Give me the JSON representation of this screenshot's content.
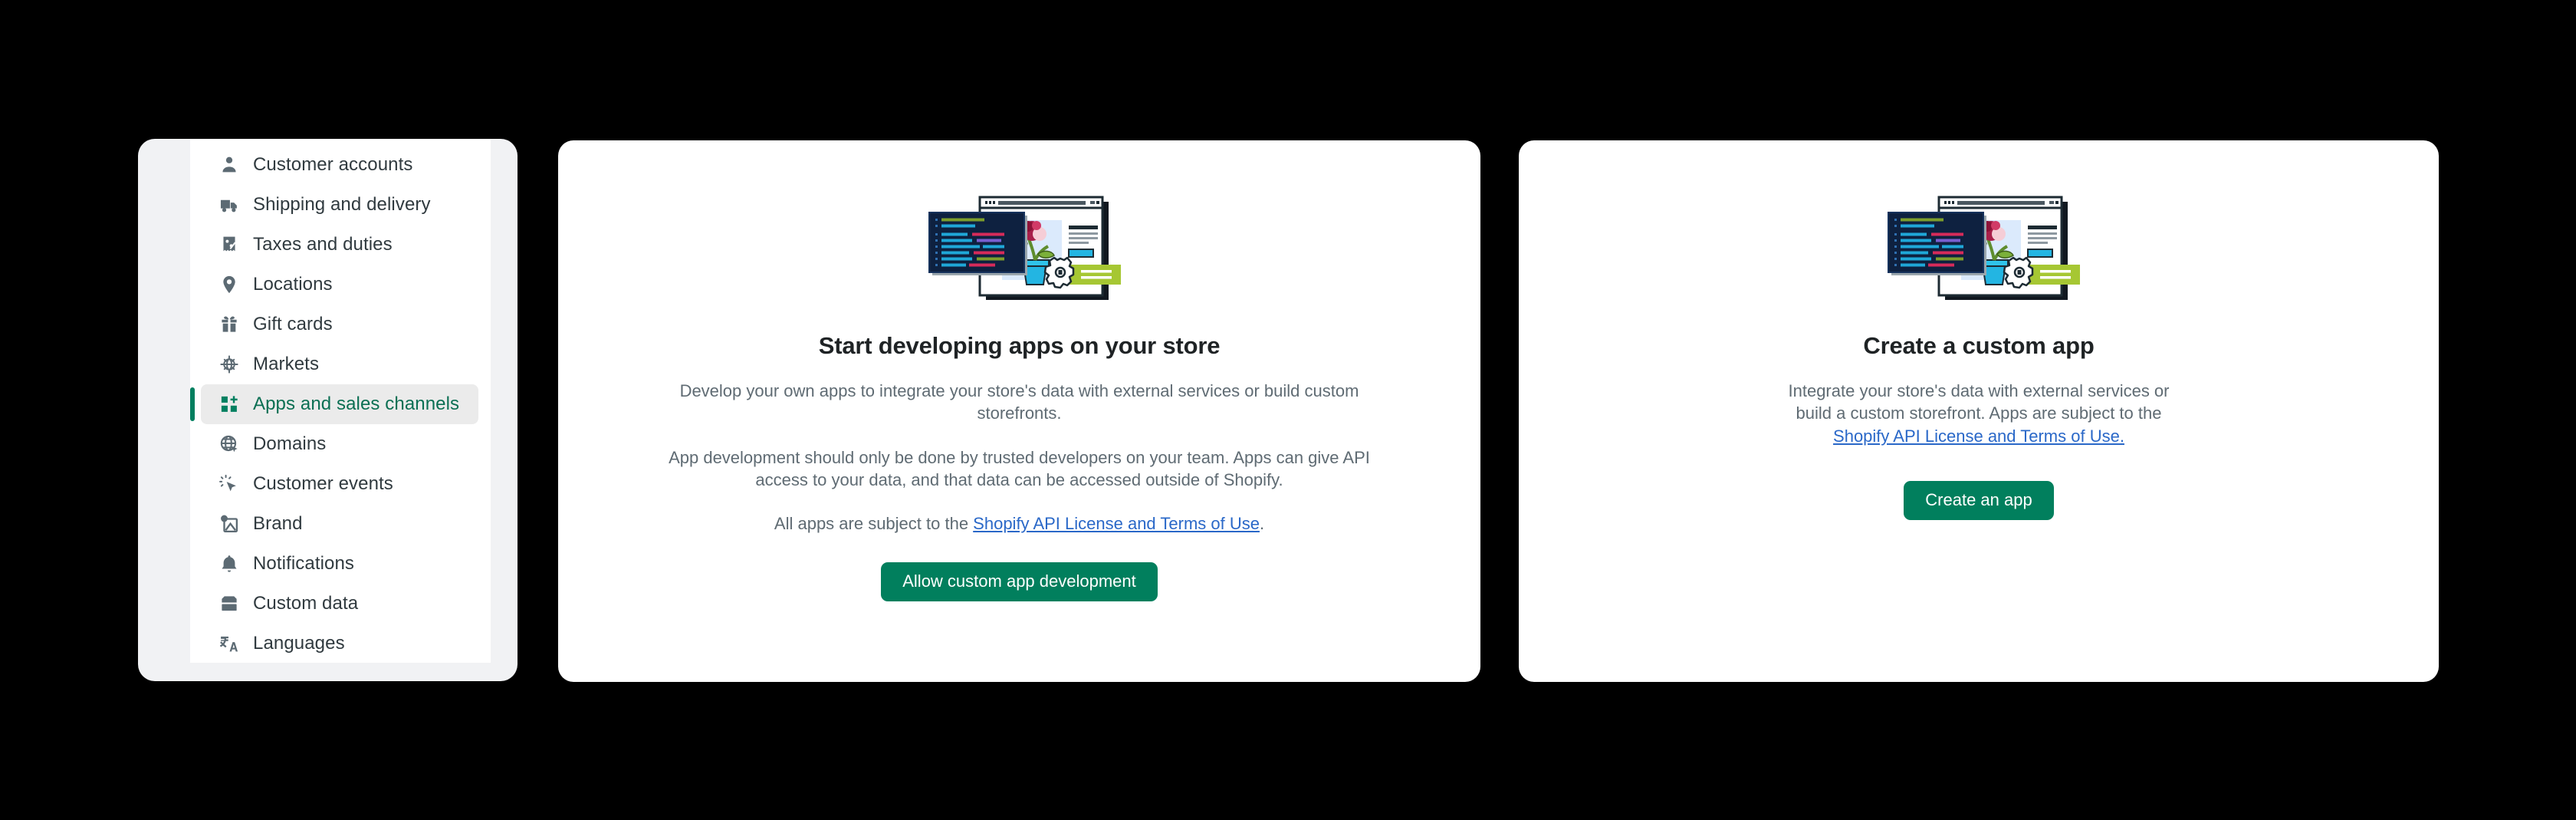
{
  "sidebar": {
    "items": [
      {
        "label": "Customer accounts",
        "icon": "person-icon",
        "selected": false
      },
      {
        "label": "Shipping and delivery",
        "icon": "truck-icon",
        "selected": false
      },
      {
        "label": "Taxes and duties",
        "icon": "receipt-percent-icon",
        "selected": false
      },
      {
        "label": "Locations",
        "icon": "map-pin-icon",
        "selected": false
      },
      {
        "label": "Gift cards",
        "icon": "gift-icon",
        "selected": false
      },
      {
        "label": "Markets",
        "icon": "globe-target-icon",
        "selected": false
      },
      {
        "label": "Apps and sales channels",
        "icon": "apps-plus-icon",
        "selected": true
      },
      {
        "label": "Domains",
        "icon": "globe-arrow-icon",
        "selected": false
      },
      {
        "label": "Customer events",
        "icon": "click-cursor-icon",
        "selected": false
      },
      {
        "label": "Brand",
        "icon": "brand-image-icon",
        "selected": false
      },
      {
        "label": "Notifications",
        "icon": "bell-icon",
        "selected": false
      },
      {
        "label": "Custom data",
        "icon": "database-icon",
        "selected": false
      },
      {
        "label": "Languages",
        "icon": "translate-icon",
        "selected": false
      }
    ]
  },
  "develop_card": {
    "illustration_name": "app-development-illustration",
    "title": "Start developing apps on your store",
    "paragraph_1": "Develop your own apps to integrate your store's data with external services or build custom storefronts.",
    "paragraph_2": "App development should only be done by trusted developers on your team. Apps can give API access to your data, and that data can be accessed outside of Shopify.",
    "paragraph_3_prefix": "All apps are subject to the ",
    "paragraph_3_link": "Shopify API License and Terms of Use",
    "paragraph_3_suffix": ".",
    "button_label": "Allow custom app development"
  },
  "create_card": {
    "illustration_name": "app-development-illustration",
    "title": "Create a custom app",
    "paragraph_prefix": "Integrate your store's data with external services or build a custom storefront. Apps are subject to the ",
    "paragraph_link": "Shopify API License and Terms of Use.",
    "button_label": "Create an app"
  },
  "colors": {
    "background": "#000000",
    "card_background": "#ffffff",
    "sidebar_shell": "#f1f2f4",
    "accent_green": "#017f5d",
    "selected_text_green": "#0b6f53",
    "selected_bar_green": "#007f5f",
    "selected_row_background": "#ebebeb",
    "link_blue": "#2a68c8",
    "icon_gray": "#5c6a73",
    "body_text_gray": "#5f6b73",
    "title_text": "#1f2325"
  }
}
